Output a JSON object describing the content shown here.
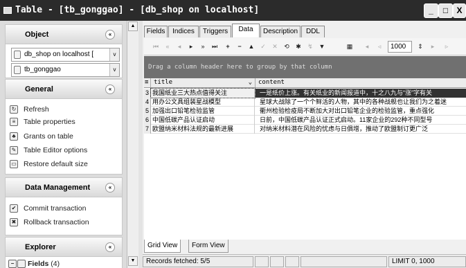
{
  "window": {
    "title": "Table - [tb_gonggao] - [db_shop on localhost]",
    "minimize": "_",
    "maximize": "□",
    "close": "X"
  },
  "sidebar": {
    "object": {
      "title": "Object",
      "collapse_glyph": "«",
      "connection": "db_shop on localhost [",
      "table": "tb_gonggao",
      "dropdown_glyph": "v"
    },
    "general": {
      "title": "General",
      "collapse_glyph": "«",
      "items": [
        {
          "label": "Refresh",
          "icon": "refresh-icon",
          "glyph": "↻"
        },
        {
          "label": "Table properties",
          "icon": "table-properties-icon",
          "glyph": "≡"
        },
        {
          "label": "Grants on table",
          "icon": "grants-icon",
          "glyph": "♣"
        },
        {
          "label": "Table Editor options",
          "icon": "editor-options-icon",
          "glyph": "✎"
        },
        {
          "label": "Restore default size",
          "icon": "restore-size-icon",
          "glyph": "▭"
        }
      ]
    },
    "data_management": {
      "title": "Data Management",
      "collapse_glyph": "«",
      "items": [
        {
          "label": "Commit transaction",
          "icon": "check-icon",
          "glyph": "✔"
        },
        {
          "label": "Rollback transaction",
          "icon": "rollback-icon",
          "glyph": "✖"
        }
      ]
    },
    "explorer": {
      "title": "Explorer",
      "collapse_glyph": "«",
      "fields_label": "Fields",
      "fields_count": "(4)",
      "expand_glyph": "−"
    }
  },
  "tabs": [
    {
      "label": "Fields"
    },
    {
      "label": "Indices"
    },
    {
      "label": "Triggers"
    },
    {
      "label": "Data"
    },
    {
      "label": "Description"
    },
    {
      "label": "DDL"
    }
  ],
  "active_tab": "Data",
  "toolbar": {
    "first": "⏮",
    "prev_page": "«",
    "prev": "◂",
    "next": "▸",
    "next_page": "»",
    "last": "⏭",
    "add": "+",
    "delete": "−",
    "up": "▲",
    "post": "✓",
    "cancel": "✕",
    "refresh": "⟲",
    "star": "✱",
    "filter": "▼",
    "page_size": "1000"
  },
  "grid": {
    "group_hint": "Drag a column header here to group by that column",
    "columns": [
      "title",
      "content"
    ],
    "rows": [
      {
        "num": "3",
        "title": "我国纸业三大热点值得关注",
        "content": "一是纸价上涨。有关纸业的新闻报道中，十之八九与“涨”字有关"
      },
      {
        "num": "4",
        "title": "用办公文具组装星战模型",
        "content": "星球大战除了一个个鲜活的人物，其中的各种战舰也让我们为之着迷"
      },
      {
        "num": "5",
        "title": "加强出口铅笔检验监管",
        "content": "衢州检验检疫局不断加大对出口铅笔企业的检验监管，重点强化"
      },
      {
        "num": "6",
        "title": "中国低碳产品认证启动",
        "content": "日前，中国低碳产品认证正式启动。11家企业的292种不同型号"
      },
      {
        "num": "7",
        "title": "欧盟纳米材料法规的最新进展",
        "content": "对纳米材料潜在风险的忧虑与日俱增，推动了欧盟制订更广泛"
      }
    ]
  },
  "view_tabs": [
    {
      "label": "Grid View"
    },
    {
      "label": "Form View"
    }
  ],
  "status": {
    "fetched": "Records fetched: 5/5",
    "limit": "LIMIT 0, 1000"
  }
}
